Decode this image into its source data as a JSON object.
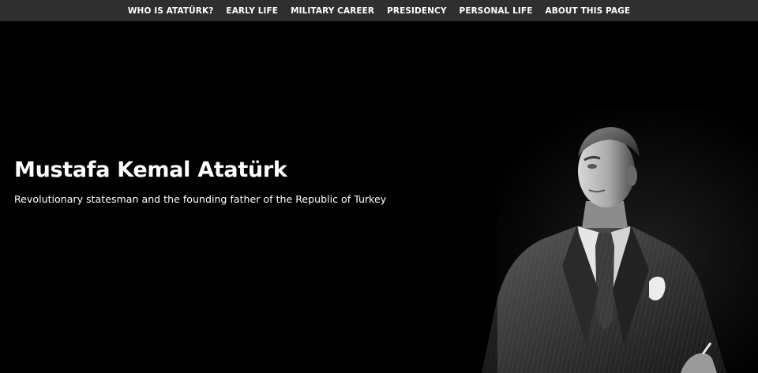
{
  "nav": {
    "items": [
      {
        "label": "WHO IS ATATÜRK?"
      },
      {
        "label": "EARLY LIFE"
      },
      {
        "label": "MILITARY CAREER"
      },
      {
        "label": "PRESIDENCY"
      },
      {
        "label": "PERSONAL LIFE"
      },
      {
        "label": "ABOUT THIS PAGE"
      }
    ]
  },
  "hero": {
    "title": "Mustafa Kemal Atatürk",
    "subtitle": "Revolutionary statesman and the founding father of the Republic of Turkey",
    "image_icon": "black-and-white-portrait-photo"
  },
  "colors": {
    "nav_background": "#2f2f2f",
    "hero_background": "#000000",
    "text": "#ffffff"
  }
}
